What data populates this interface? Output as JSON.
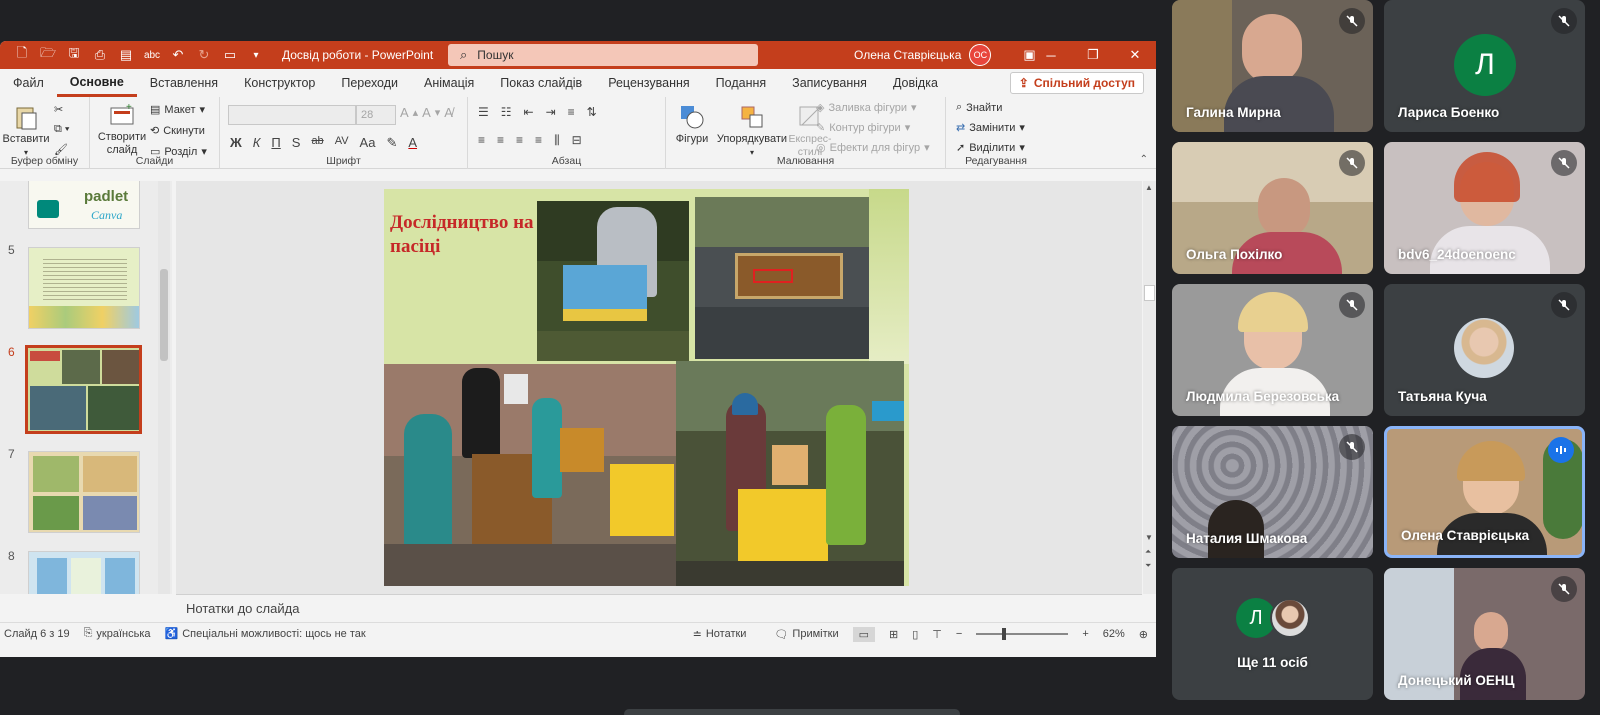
{
  "ppt": {
    "doc_title": "Досвід роботи  -  PowerPoint",
    "search_placeholder": "Пошук",
    "user_name": "Олена Ставрієцька",
    "user_initials": "ОС",
    "tabs": [
      "Файл",
      "Основне",
      "Вставлення",
      "Конструктор",
      "Переходи",
      "Анімація",
      "Показ слайдів",
      "Рецензування",
      "Подання",
      "Записування",
      "Довідка"
    ],
    "active_tab": "Основне",
    "share_label": "Спільний доступ",
    "ribbon": {
      "paste": "Вставити",
      "clipboard_group": "Буфер обміну",
      "new_slide": "Створити слайд",
      "layout": "Макет",
      "reset": "Скинути",
      "section": "Розділ",
      "slides_group": "Слайди",
      "font_size": "28",
      "font_group": "Шрифт",
      "paragraph_group": "Абзац",
      "shapes": "Фігури",
      "arrange": "Упорядкувати",
      "quick_styles": "Експрес-стилі",
      "shape_fill": "Заливка фігури",
      "shape_outline": "Контур фігури",
      "shape_effects": "Ефекти для фігур",
      "drawing_group": "Малювання",
      "find": "Знайти",
      "replace": "Замінити",
      "select": "Виділити",
      "editing_group": "Редагування",
      "fmt_bold": "Ж",
      "fmt_italic": "К",
      "fmt_underline": "П",
      "fmt_strike": "S",
      "fmt_abc": "ab",
      "fmt_spacing": "AV",
      "fmt_case": "Aa"
    },
    "thumbnails": [
      {
        "num": "5"
      },
      {
        "num": "6"
      },
      {
        "num": "7"
      },
      {
        "num": "8"
      }
    ],
    "thumb_logos": {
      "padlet": "padlet",
      "canva": "Canva"
    },
    "slide_title": "Дослідництво на пасіці",
    "notes_placeholder": "Нотатки до слайда",
    "status": {
      "slide_counter": "Слайд 6 з 19",
      "language": "українська",
      "accessibility": "Спеціальні можливості: щось не так",
      "notes": "Нотатки",
      "comments": "Примітки",
      "zoom": "62%"
    }
  },
  "participants": [
    {
      "name": "Галина Мирна",
      "muted": true
    },
    {
      "name": "Лариса Боенко",
      "muted": true,
      "initial": "Л"
    },
    {
      "name": "Ольга Похілко",
      "muted": true
    },
    {
      "name": "bdv6_24doenoenc",
      "muted": true
    },
    {
      "name": "Людмила Березовська",
      "muted": true
    },
    {
      "name": "Татьяна Куча",
      "muted": true
    },
    {
      "name": "Наталия Шмакова",
      "muted": true
    },
    {
      "name": "Олена Ставрієцька",
      "speaking": true
    },
    {
      "name": "Ще 11 осіб",
      "initial": "Л"
    },
    {
      "name": "Донецький ОЕНЦ",
      "muted": true
    }
  ],
  "colors": {
    "ppt_brand": "#c43e1c",
    "meet_tile": "#3c4043",
    "meet_bg": "#202124",
    "speaking_border": "#8ab4f8",
    "avatar_green": "#0b8043"
  }
}
